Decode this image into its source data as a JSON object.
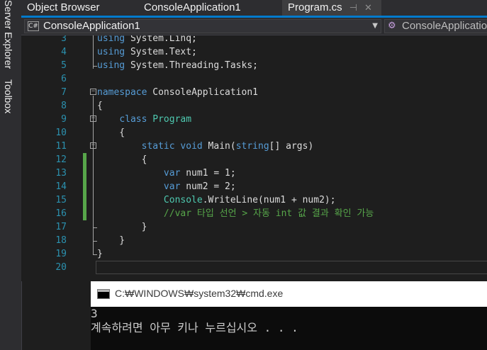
{
  "side_panel": {
    "tabs": [
      "Server Explorer",
      "Toolbox"
    ]
  },
  "tabs": [
    {
      "label": "Object Browser"
    },
    {
      "label": "ConsoleApplication1"
    },
    {
      "label": "Program.cs",
      "pin_icon": "pin-icon",
      "close_icon": "close-icon"
    }
  ],
  "nav_bar": {
    "project_badge": "C#",
    "project": "ConsoleApplication1",
    "member": "ConsoleApplicatio"
  },
  "code_lines": [
    {
      "num": "3",
      "tokens": [
        [
          "kw",
          "using"
        ],
        [
          "pl",
          " System.Linq;"
        ]
      ]
    },
    {
      "num": "4",
      "tokens": [
        [
          "kw",
          "using"
        ],
        [
          "pl",
          " System.Text;"
        ]
      ]
    },
    {
      "num": "5",
      "tokens": [
        [
          "kw",
          "using"
        ],
        [
          "pl",
          " System.Threading.Tasks;"
        ]
      ]
    },
    {
      "num": "6",
      "tokens": []
    },
    {
      "num": "7",
      "tokens": [
        [
          "kw",
          "namespace"
        ],
        [
          "pl",
          " ConsoleApplication1"
        ]
      ]
    },
    {
      "num": "8",
      "tokens": [
        [
          "pl",
          "{"
        ]
      ]
    },
    {
      "num": "9",
      "tokens": [
        [
          "pl",
          "    "
        ],
        [
          "kw",
          "class"
        ],
        [
          "pl",
          " "
        ],
        [
          "ty",
          "Program"
        ]
      ]
    },
    {
      "num": "10",
      "tokens": [
        [
          "pl",
          "    {"
        ]
      ]
    },
    {
      "num": "11",
      "tokens": [
        [
          "pl",
          "        "
        ],
        [
          "kw",
          "static"
        ],
        [
          "pl",
          " "
        ],
        [
          "kw",
          "void"
        ],
        [
          "pl",
          " Main("
        ],
        [
          "kw",
          "string"
        ],
        [
          "pl",
          "[] args)"
        ]
      ]
    },
    {
      "num": "12",
      "tokens": [
        [
          "pl",
          "        {"
        ]
      ]
    },
    {
      "num": "13",
      "tokens": [
        [
          "pl",
          "            "
        ],
        [
          "kw",
          "var"
        ],
        [
          "pl",
          " num1 = 1;"
        ]
      ]
    },
    {
      "num": "14",
      "tokens": [
        [
          "pl",
          "            "
        ],
        [
          "kw",
          "var"
        ],
        [
          "pl",
          " num2 = 2;"
        ]
      ]
    },
    {
      "num": "15",
      "tokens": [
        [
          "pl",
          "            "
        ],
        [
          "ty",
          "Console"
        ],
        [
          "pl",
          ".WriteLine(num1 + num2);"
        ]
      ]
    },
    {
      "num": "16",
      "tokens": [
        [
          "pl",
          "            "
        ],
        [
          "cm",
          "//var 타입 선언 > 자동 int 값 결과 확인 가능"
        ]
      ]
    },
    {
      "num": "17",
      "tokens": [
        [
          "pl",
          "        }"
        ]
      ]
    },
    {
      "num": "18",
      "tokens": [
        [
          "pl",
          "    }"
        ]
      ]
    },
    {
      "num": "19",
      "tokens": [
        [
          "pl",
          "}"
        ]
      ]
    },
    {
      "num": "20",
      "tokens": []
    }
  ],
  "fold_marker": "⊟",
  "console": {
    "title": "C:₩WINDOWS₩system32₩cmd.exe",
    "lines": [
      "3",
      "계속하려면 아무 키나 누르십시오 . . ."
    ]
  },
  "colors": {
    "keyword": "#569cd6",
    "type": "#4ec9b0",
    "comment": "#57a64a",
    "line_number": "#2b91af",
    "accent": "#007acc",
    "change_bar": "#57a64a"
  }
}
